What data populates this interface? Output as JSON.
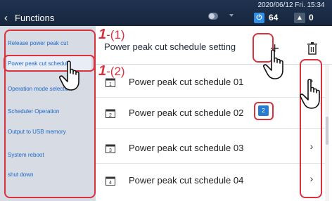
{
  "header": {
    "back_label": "Functions",
    "datetime": "2020/06/12 Fri. 15:34",
    "info_count": "64",
    "warning_count": "0",
    "back_icon": "chevron-left-icon",
    "info_icon": "power-icon",
    "warning_icon": "warning-triangle-icon"
  },
  "sidebar": {
    "items": [
      {
        "label": "Release power peak cut"
      },
      {
        "label": "Power peak cut schedule"
      },
      {
        "label": "Operation mode selection"
      },
      {
        "label": "Scheduler Operation"
      },
      {
        "label": "Output to USB memory"
      },
      {
        "label": "System reboot"
      },
      {
        "label": "shut down"
      }
    ]
  },
  "main": {
    "title": "Power peak cut schedule setting",
    "rows": [
      {
        "label": "Power peak cut schedule 01",
        "icon_number": "1",
        "badge": ""
      },
      {
        "label": "Power peak cut schedule 02",
        "icon_number": "2",
        "badge": "2"
      },
      {
        "label": "Power peak cut schedule 03",
        "icon_number": "3",
        "badge": ""
      },
      {
        "label": "Power peak cut schedule 04",
        "icon_number": "4",
        "badge": ""
      }
    ]
  },
  "callouts": {
    "step1": {
      "num": "1",
      "text": "-(1)"
    },
    "step2": {
      "num": "1",
      "text": "-(2)"
    }
  },
  "colors": {
    "header_bg": "#1f3350",
    "sidebar_bg": "#d7dce4",
    "link_blue": "#1c67c9",
    "highlight_red": "#d8323f",
    "info_blue": "#2f8ee6"
  }
}
